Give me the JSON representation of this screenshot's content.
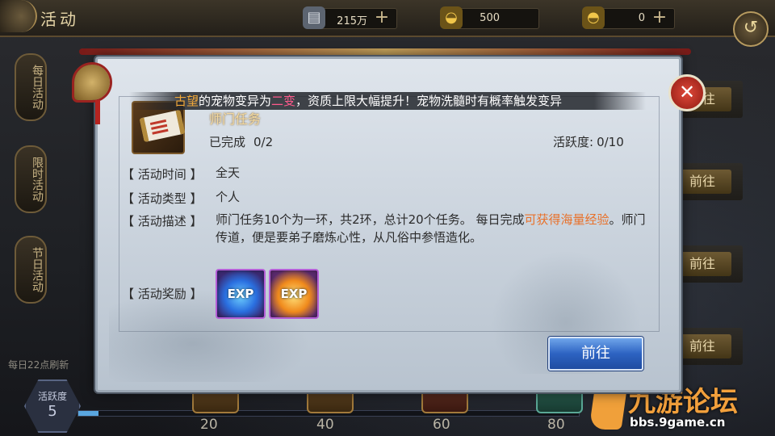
{
  "header": {
    "title": "活动",
    "currencies": [
      {
        "icon": "silver-ingot-icon",
        "value": "215万"
      },
      {
        "icon": "gold-ingot-icon",
        "value": "500"
      },
      {
        "icon": "bound-gold-icon",
        "value": "0"
      }
    ]
  },
  "side_tabs": [
    "每日活动",
    "限时活动",
    "节日活动"
  ],
  "refresh_note": "每日22点刷新",
  "right_buttons": [
    "前往",
    "前往",
    "前往",
    "前往"
  ],
  "announcement": {
    "name": "古望",
    "text_1": "的宠物变异为",
    "highlight": "二变",
    "text_2": "，资质上限大幅提升！宠物洗髓时有概率触发变异"
  },
  "dialog": {
    "task_name": "师门任务",
    "completed_label": "已完成",
    "completed_value": "0/2",
    "liveness_label": "活跃度:",
    "liveness_value": "0/10",
    "time_label": "【 活动时间 】",
    "time_value": "全天",
    "type_label": "【 活动类型 】",
    "type_value": "个人",
    "desc_label": "【 活动描述 】",
    "desc_part1": "师门任务10个为一环，共2环，总计20个任务。 每日完成",
    "desc_highlight": "可获得海量经验",
    "desc_part2": "。师门传道，便是要弟子磨炼心性，从凡俗中参悟造化。",
    "reward_label": "【 活动奖励 】",
    "rewards": [
      "EXP",
      "EXP"
    ],
    "go_button": "前往"
  },
  "activity_bar": {
    "label": "活跃度",
    "value": "5",
    "progress": 0.04,
    "milestones": [
      "20",
      "40",
      "60",
      "80"
    ]
  },
  "watermark": {
    "brand": "九游论坛",
    "url": "bbs.9game.cn"
  }
}
